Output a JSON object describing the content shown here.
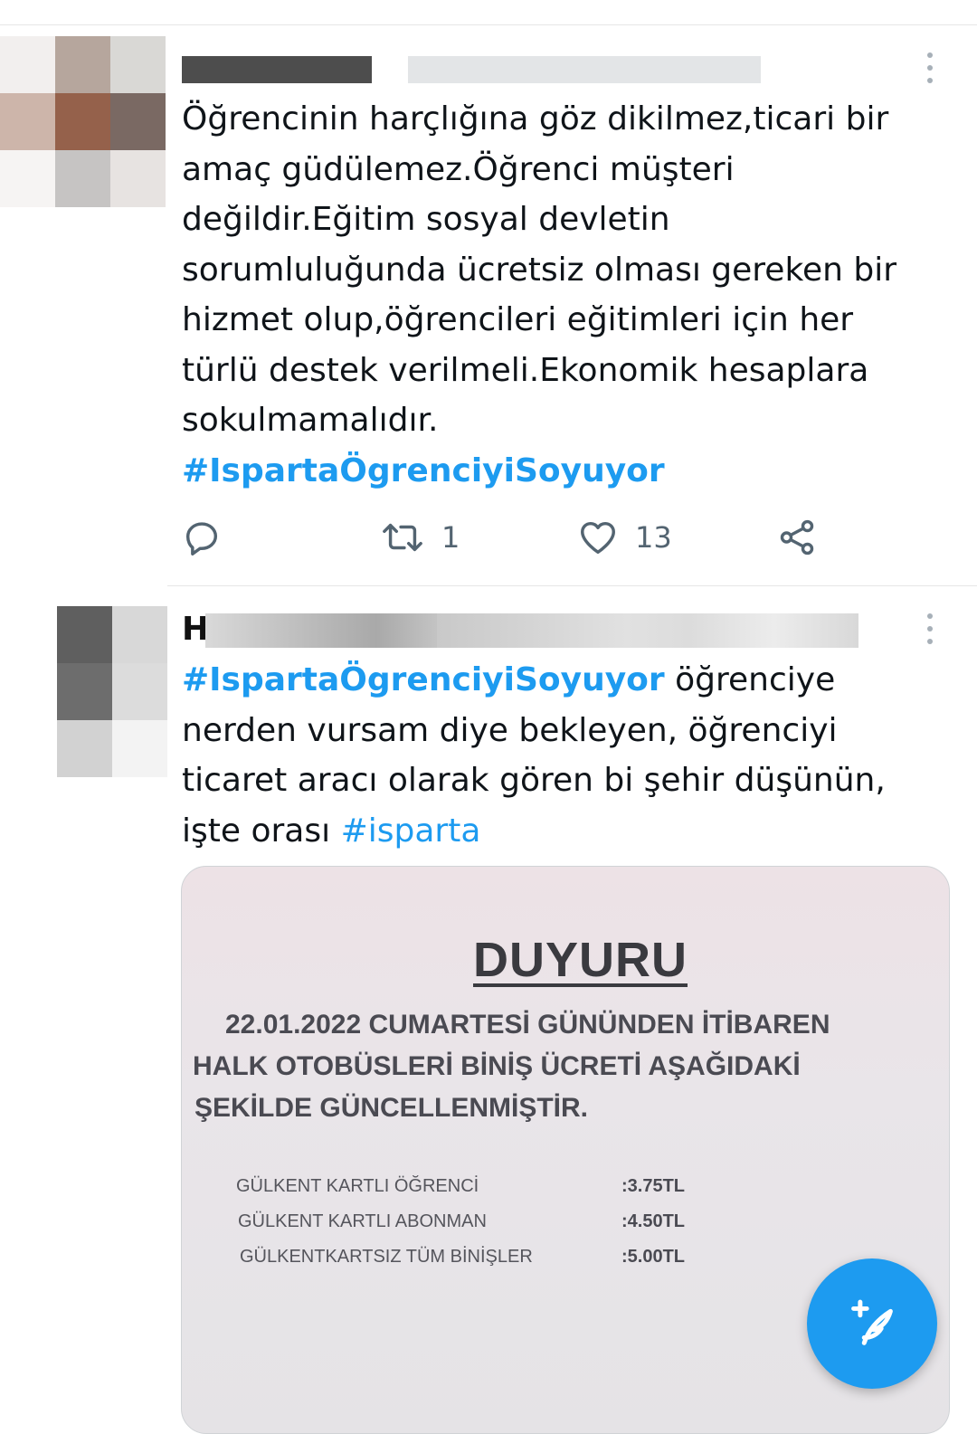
{
  "tweet1": {
    "name_visible": "",
    "text_lines": [
      "Öğrencinin harçlığına göz dikilmez,ticari bir",
      "amaç güdülemez.Öğrenci müşteri",
      "değildir.Eğitim sosyal devletin",
      "sorumluluğunda ücretsiz olması gereken bir",
      "hizmet olup,öğrencileri eğitimleri için her",
      "türlü destek verilmeli.Ekonomik hesaplara",
      "sokulmamalıdır."
    ],
    "hashtag": "#IspartaÖgrenciyiSoyuyor",
    "retweet_count": "1",
    "like_count": "13"
  },
  "tweet2": {
    "name_initial": "H",
    "hashtag_lead": "#IspartaÖgrenciyiSoyuyor",
    "text_line1_tail": " öğrenciye",
    "text_line2": "nerden vursam diye bekleyen, öğrenciyi",
    "text_line3": "ticaret aracı olarak gören bi şehir düşünün,",
    "text_line4_lead": "işte orası ",
    "hashtag_tail": "#isparta",
    "media": {
      "title": "DUYURU",
      "line1": "22.01.2022  CUMARTESİ  GÜNÜNDEN  İTİBAREN",
      "line2": "HALK  OTOBÜSLERİ  BİNİŞ  ÜCRETİ  AŞAĞIDAKİ",
      "line3": "ŞEKİLDE GÜNCELLENMİŞTİR.",
      "fares": [
        {
          "label": "GÜLKENT KARTLI ÖĞRENCİ",
          "value": ":3.75TL"
        },
        {
          "label": "GÜLKENT KARTLI ABONMAN",
          "value": ":4.50TL"
        },
        {
          "label": "GÜLKENTKARTSIZ TÜM BİNİŞLER",
          "value": ":5.00TL"
        }
      ]
    }
  },
  "icons": {
    "reply": "reply-icon",
    "retweet": "retweet-icon",
    "like": "heart-icon",
    "share": "share-icon",
    "more": "more-icon",
    "compose": "compose-tweet-icon"
  },
  "colors": {
    "accent": "#1d9bf0",
    "text": "#0f1419",
    "muted": "#536471"
  }
}
